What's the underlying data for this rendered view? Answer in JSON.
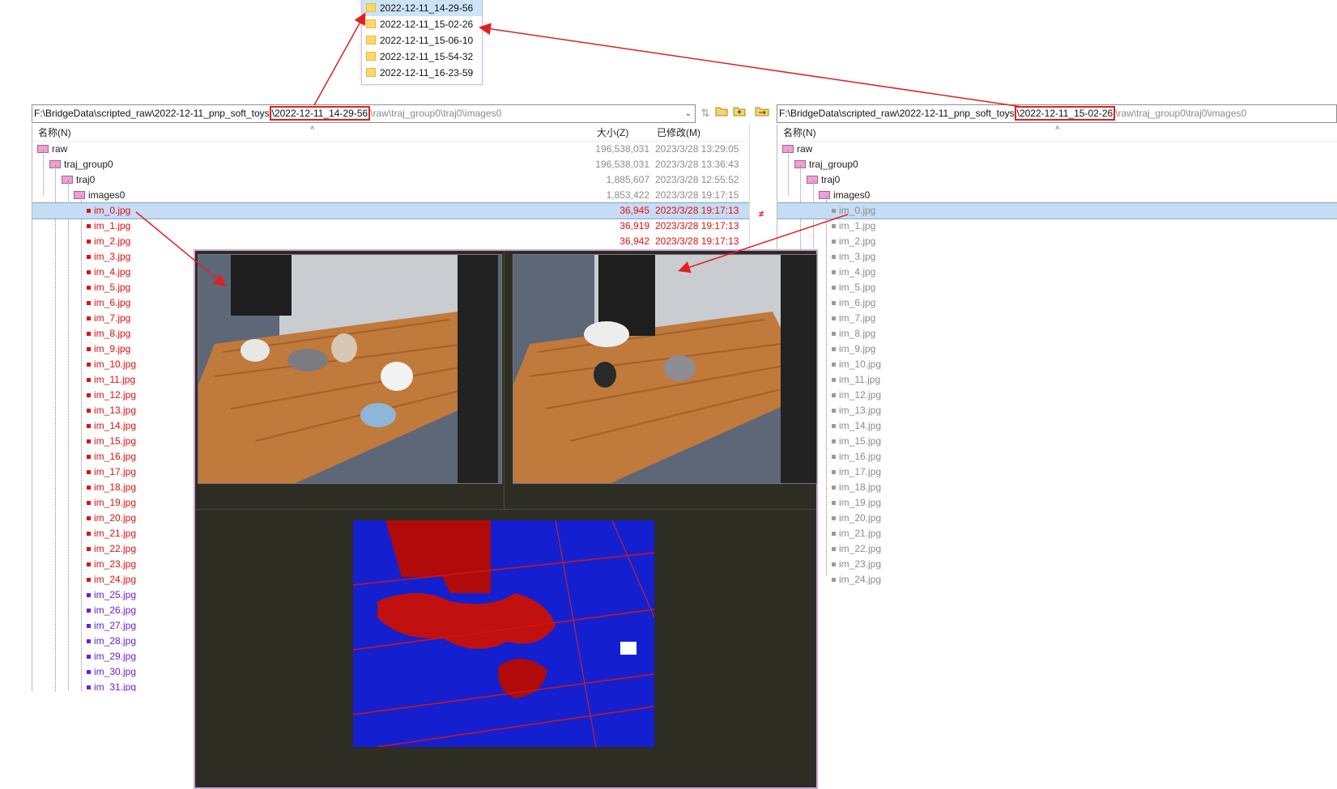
{
  "folder_popup": {
    "items": [
      {
        "name": "2022-12-11_14-29-56",
        "selected": true
      },
      {
        "name": "2022-12-11_15-02-26",
        "selected": false
      },
      {
        "name": "2022-12-11_15-06-10",
        "selected": false
      },
      {
        "name": "2022-12-11_15-54-32",
        "selected": false
      },
      {
        "name": "2022-12-11_16-23-59",
        "selected": false
      }
    ]
  },
  "left_pane": {
    "path_prefix": "F:\\BridgeData\\scripted_raw\\2022-12-11_pnp_soft_toys",
    "path_highlight": "\\2022-12-11_14-29-56",
    "path_suffix": "\\raw\\traj_group0\\traj0\\images0",
    "col_name": "名称(N)",
    "col_size": "大小(Z)",
    "col_modified": "已修改(M)",
    "folders": [
      {
        "name": "raw",
        "size": "196,538,031",
        "modified": "2023/3/28 13:29:05",
        "level": 0
      },
      {
        "name": "traj_group0",
        "size": "196,538,031",
        "modified": "2023/3/28 13:36:43",
        "level": 1
      },
      {
        "name": "traj0",
        "size": "1,885,607",
        "modified": "2023/3/28 12:55:52",
        "level": 2
      },
      {
        "name": "images0",
        "size": "1,853,422",
        "modified": "2023/3/28 19:17:15",
        "level": 3
      }
    ],
    "diff_marker": "≠",
    "files": [
      {
        "name": "im_0.jpg",
        "size": "36,945",
        "modified": "2023/3/28 19:17:13",
        "status": "diff",
        "selected": true
      },
      {
        "name": "im_1.jpg",
        "size": "36,919",
        "modified": "2023/3/28 19:17:13",
        "status": "diff"
      },
      {
        "name": "im_2.jpg",
        "size": "36,942",
        "modified": "2023/3/28 19:17:13",
        "status": "diff"
      },
      {
        "name": "im_3.jpg",
        "status": "diff"
      },
      {
        "name": "im_4.jpg",
        "status": "diff"
      },
      {
        "name": "im_5.jpg",
        "status": "diff"
      },
      {
        "name": "im_6.jpg",
        "status": "diff"
      },
      {
        "name": "im_7.jpg",
        "status": "diff"
      },
      {
        "name": "im_8.jpg",
        "status": "diff"
      },
      {
        "name": "im_9.jpg",
        "status": "diff"
      },
      {
        "name": "im_10.jpg",
        "status": "diff"
      },
      {
        "name": "im_11.jpg",
        "status": "diff"
      },
      {
        "name": "im_12.jpg",
        "status": "diff"
      },
      {
        "name": "im_13.jpg",
        "status": "diff"
      },
      {
        "name": "im_14.jpg",
        "status": "diff"
      },
      {
        "name": "im_15.jpg",
        "status": "diff"
      },
      {
        "name": "im_16.jpg",
        "status": "diff"
      },
      {
        "name": "im_17.jpg",
        "status": "diff"
      },
      {
        "name": "im_18.jpg",
        "status": "diff"
      },
      {
        "name": "im_19.jpg",
        "status": "diff"
      },
      {
        "name": "im_20.jpg",
        "status": "diff"
      },
      {
        "name": "im_21.jpg",
        "status": "diff"
      },
      {
        "name": "im_22.jpg",
        "status": "diff"
      },
      {
        "name": "im_23.jpg",
        "status": "diff"
      },
      {
        "name": "im_24.jpg",
        "status": "diff"
      },
      {
        "name": "im_25.jpg",
        "status": "orphan"
      },
      {
        "name": "im_26.jpg",
        "status": "orphan"
      },
      {
        "name": "im_27.jpg",
        "status": "orphan"
      },
      {
        "name": "im_28.jpg",
        "status": "orphan"
      },
      {
        "name": "im_29.jpg",
        "status": "orphan"
      },
      {
        "name": "im_30.jpg",
        "status": "orphan"
      },
      {
        "name": "im_31.jpg",
        "status": "orphan"
      }
    ]
  },
  "right_pane": {
    "path_prefix": "F:\\BridgeData\\scripted_raw\\2022-12-11_pnp_soft_toys",
    "path_highlight": "\\2022-12-11_15-02-26",
    "path_suffix": "\\raw\\traj_group0\\traj0\\images0",
    "col_name": "名称(N)",
    "folders": [
      {
        "name": "raw",
        "level": 0
      },
      {
        "name": "traj_group0",
        "level": 1
      },
      {
        "name": "traj0",
        "level": 2
      },
      {
        "name": "images0",
        "level": 3
      }
    ],
    "files": [
      "im_0.jpg",
      "im_1.jpg",
      "im_2.jpg",
      "im_3.jpg",
      "im_4.jpg",
      "im_5.jpg",
      "im_6.jpg",
      "im_7.jpg",
      "im_8.jpg",
      "im_9.jpg",
      "im_10.jpg",
      "im_11.jpg",
      "im_12.jpg",
      "im_13.jpg",
      "im_14.jpg",
      "im_15.jpg",
      "im_16.jpg",
      "im_17.jpg",
      "im_18.jpg",
      "im_19.jpg",
      "im_20.jpg",
      "im_21.jpg",
      "im_22.jpg",
      "im_23.jpg",
      "im_24.jpg"
    ]
  },
  "icons": {
    "toolbar": [
      "swap-icon",
      "open-folder-icon",
      "up-folder-icon",
      "sync-folders-icon"
    ]
  },
  "colors": {
    "diff_text": "#e01010",
    "orphan_text": "#6a1ed8",
    "identical_text": "#8c8c8c",
    "annotation": "#e02020",
    "selection": "#c6dcf3",
    "viewer_bg": "#2d2d24"
  }
}
